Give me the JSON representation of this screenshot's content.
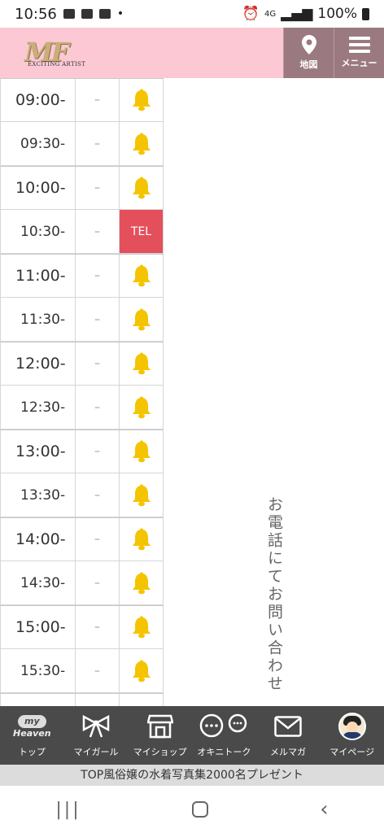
{
  "status_bar": {
    "time": "10:56",
    "dot": "•",
    "network": "4G",
    "battery": "100%"
  },
  "header": {
    "logo_sub": "EXCITING ARTIST",
    "map_label": "地図",
    "menu_label": "メニュー"
  },
  "schedule": {
    "rows": [
      {
        "time": "09:00-",
        "avail": "–",
        "status": "bell"
      },
      {
        "time": "09:30-",
        "avail": "–",
        "status": "bell"
      },
      {
        "time": "10:00-",
        "avail": "–",
        "status": "bell"
      },
      {
        "time": "10:30-",
        "avail": "–",
        "status": "TEL"
      },
      {
        "time": "11:00-",
        "avail": "–",
        "status": "bell"
      },
      {
        "time": "11:30-",
        "avail": "–",
        "status": "bell"
      },
      {
        "time": "12:00-",
        "avail": "–",
        "status": "bell"
      },
      {
        "time": "12:30-",
        "avail": "–",
        "status": "bell"
      },
      {
        "time": "13:00-",
        "avail": "–",
        "status": "bell"
      },
      {
        "time": "13:30-",
        "avail": "–",
        "status": "bell"
      },
      {
        "time": "14:00-",
        "avail": "–",
        "status": "bell"
      },
      {
        "time": "14:30-",
        "avail": "–",
        "status": "bell"
      },
      {
        "time": "15:00-",
        "avail": "–",
        "status": "bell"
      },
      {
        "time": "15:30-",
        "avail": "–",
        "status": "bell"
      }
    ],
    "bell_color": "#f5c400",
    "tel_color": "#e44f5c"
  },
  "vertical_notice": "お電話にてお問い合わせく",
  "bottom_nav": {
    "items": [
      {
        "label": "トップ",
        "icon": "heaven-logo-icon"
      },
      {
        "label": "マイガール",
        "icon": "ribbon-icon"
      },
      {
        "label": "マイショップ",
        "icon": "shop-icon"
      },
      {
        "label": "オキニトーク",
        "icon": "chat-icon"
      },
      {
        "label": "メルマガ",
        "icon": "mail-icon"
      },
      {
        "label": "マイページ",
        "icon": "avatar-icon"
      }
    ],
    "logo_bubble": "my",
    "logo_word": "Heaven"
  },
  "banner": {
    "text": "TOP風俗嬢の水着写真集2000名プレゼント"
  },
  "colors": {
    "header_bg": "#fcc8d4",
    "header_btn": "#9a7a80",
    "nav_bg": "#4a4a4a"
  }
}
